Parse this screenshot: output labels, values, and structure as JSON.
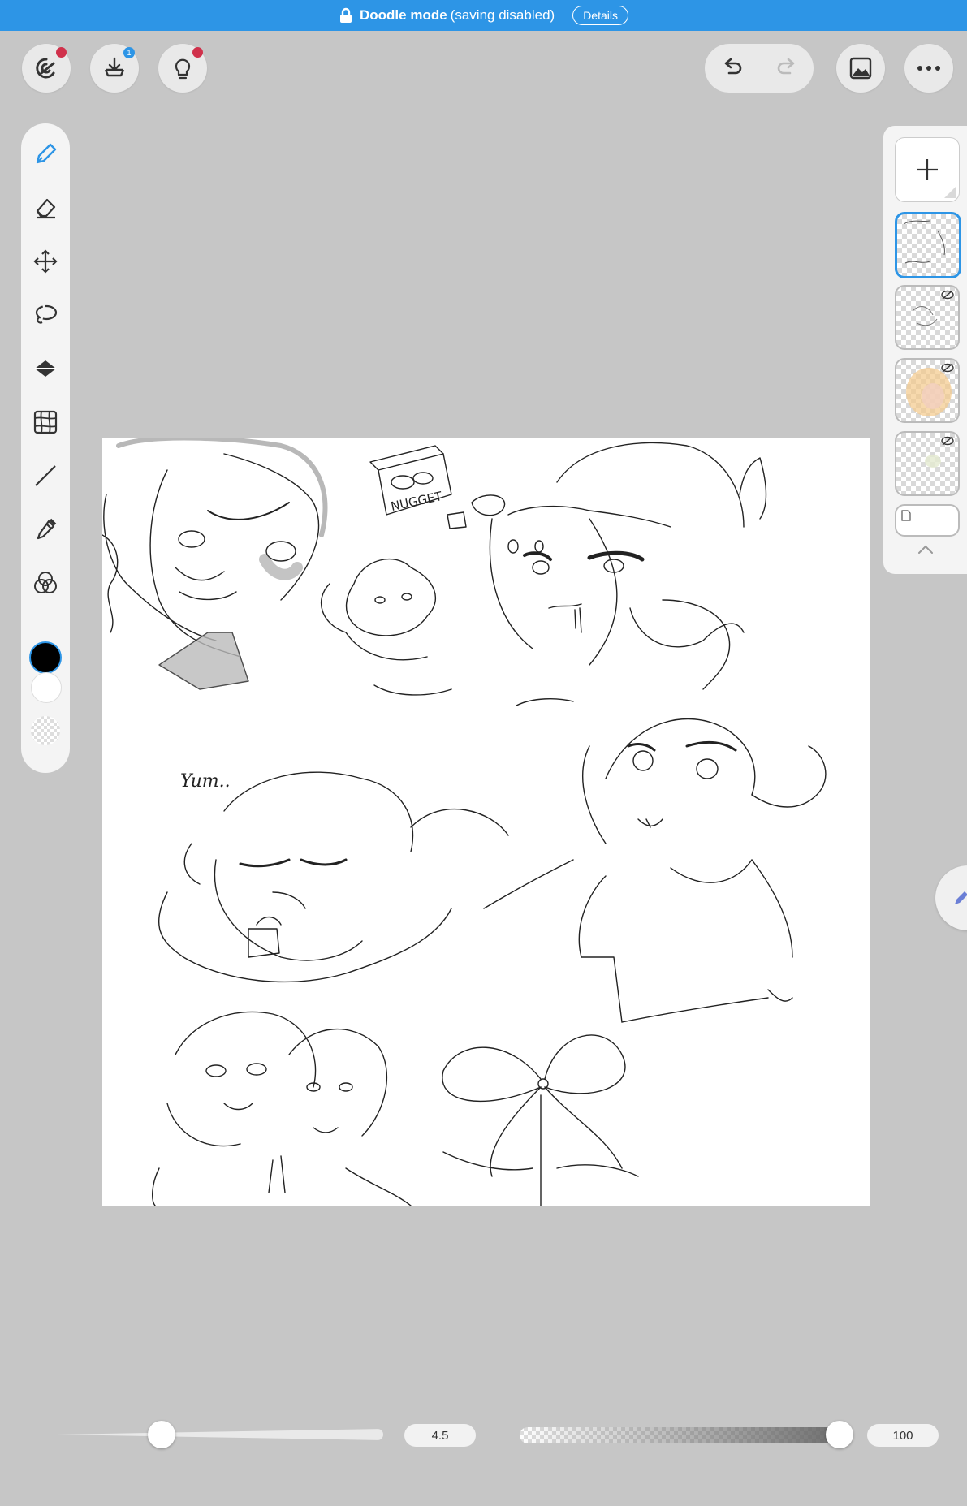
{
  "banner": {
    "mode": "Doodle mode",
    "subtitle": "(saving disabled)",
    "details_label": "Details",
    "color": "#2d95e6"
  },
  "top_left_buttons": [
    {
      "name": "clip-studio-icon",
      "has_red_dot": true
    },
    {
      "name": "download-tray-icon",
      "badge": "1"
    },
    {
      "name": "lightbulb-icon",
      "has_red_dot": true
    }
  ],
  "top_right_buttons": [
    "undo-icon",
    "redo-icon",
    "gallery-icon",
    "more-icon"
  ],
  "tools": [
    "pen-icon",
    "eraser-icon",
    "move-icon",
    "lasso-icon",
    "fill-icon",
    "grid-transform-icon",
    "line-icon",
    "eyedropper-icon",
    "color-mix-icon"
  ],
  "colors": {
    "main": "#000000",
    "sub": "#ffffff",
    "accent": "#2d95e6"
  },
  "canvas": {
    "text_on_canvas": [
      "NUGGET",
      "Yum.."
    ]
  },
  "layers": {
    "count": 4,
    "selected_index": 0,
    "hidden": [
      false,
      true,
      true,
      true
    ]
  },
  "brush": {
    "size_value": "4.5",
    "size_fraction": 0.32,
    "opacity_value": "100",
    "opacity_fraction": 1.0
  }
}
